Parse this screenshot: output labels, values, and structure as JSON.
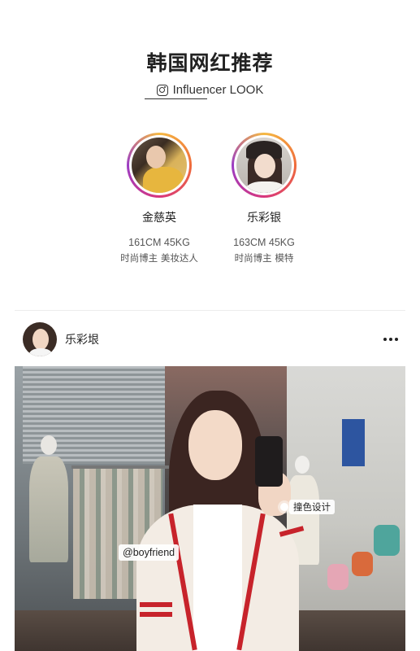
{
  "header": {
    "title": "韩国网红推荐",
    "subtitle": "Influencer LOOK",
    "subtitle_icon": "instagram-icon"
  },
  "influencers": [
    {
      "name": "金慈英",
      "stats": "161CM 45KG",
      "tags": "时尚博主 美妆达人"
    },
    {
      "name": "乐彩银",
      "stats": "163CM 45KG",
      "tags": "时尚博主 模特"
    }
  ],
  "post": {
    "username": "乐彩垠",
    "more_icon": "more-horizontal-icon",
    "tags": {
      "handle": "@boyfriend",
      "design": "撞色设计"
    }
  },
  "colors": {
    "ring_gradient": [
      "#f5b942",
      "#ef6a3a",
      "#d8367c",
      "#9b3cc4"
    ],
    "stripe": "#c7232b"
  }
}
